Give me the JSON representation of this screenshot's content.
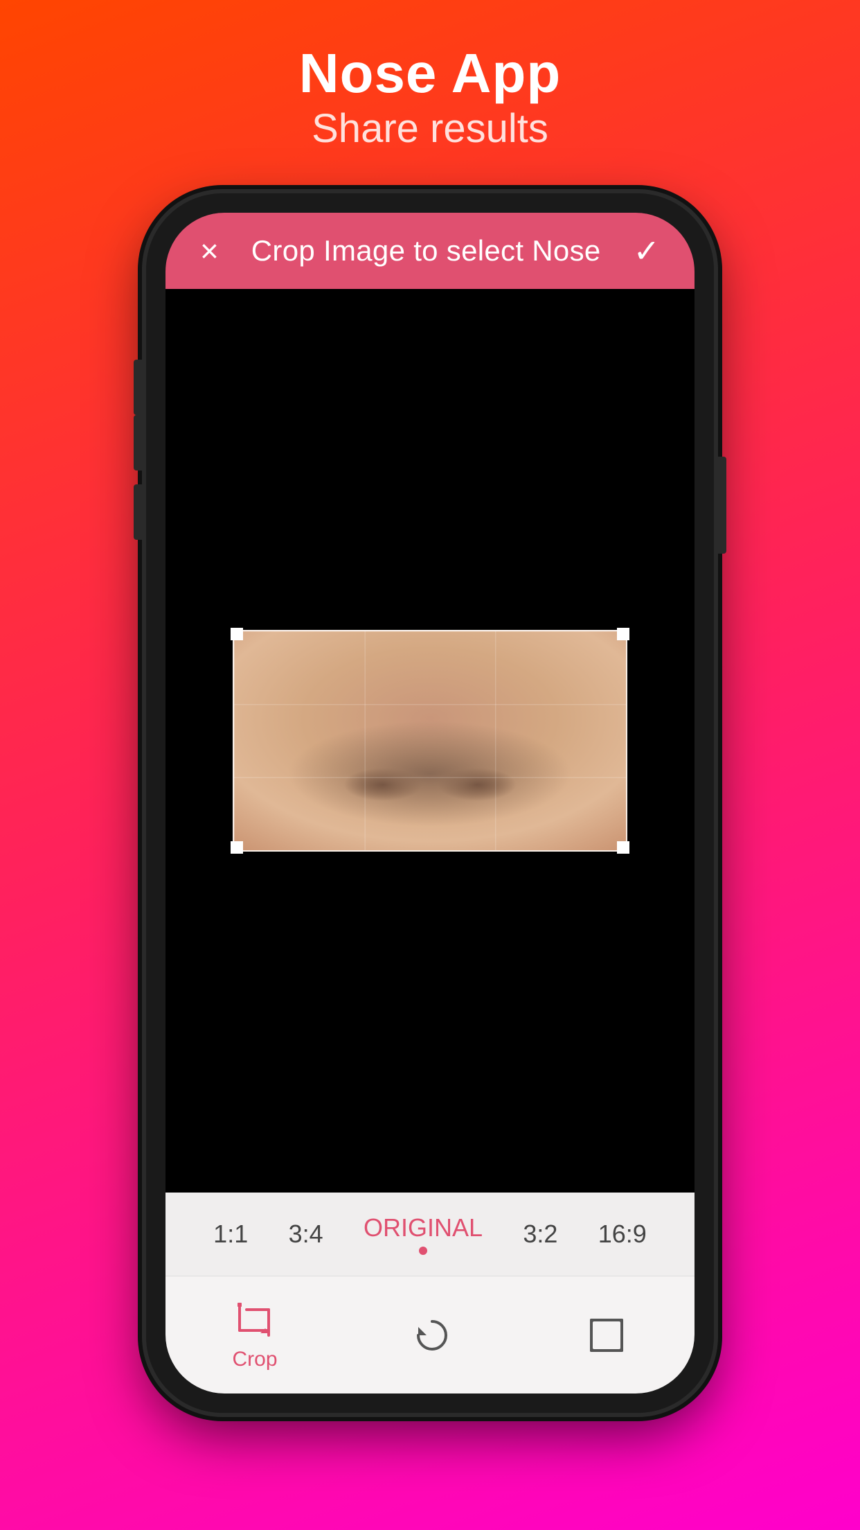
{
  "header": {
    "app_title": "Nose App",
    "app_subtitle": "Share results"
  },
  "crop_header": {
    "title": "Crop Image to select Nose",
    "close_label": "×",
    "confirm_label": "✓"
  },
  "ratio_options": [
    {
      "label": "1:1",
      "active": false
    },
    {
      "label": "3:4",
      "active": false
    },
    {
      "label": "ORIGINAL",
      "active": true
    },
    {
      "label": "3:2",
      "active": false
    },
    {
      "label": "16:9",
      "active": false
    }
  ],
  "toolbar": {
    "crop_label": "Crop",
    "rotate_label": "",
    "resize_label": ""
  }
}
